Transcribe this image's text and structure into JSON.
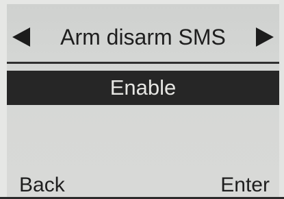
{
  "menu": {
    "title": "Arm disarm SMS",
    "prev_icon": "triangle-left",
    "next_icon": "triangle-right",
    "selected_value": "Enable"
  },
  "softkeys": {
    "left_label": "Back",
    "right_label": "Enter"
  },
  "colors": {
    "screen_background": "#d6d8d6",
    "highlight_background": "#262626",
    "highlight_text": "#e6e6e3",
    "text": "#1e1e1e"
  }
}
